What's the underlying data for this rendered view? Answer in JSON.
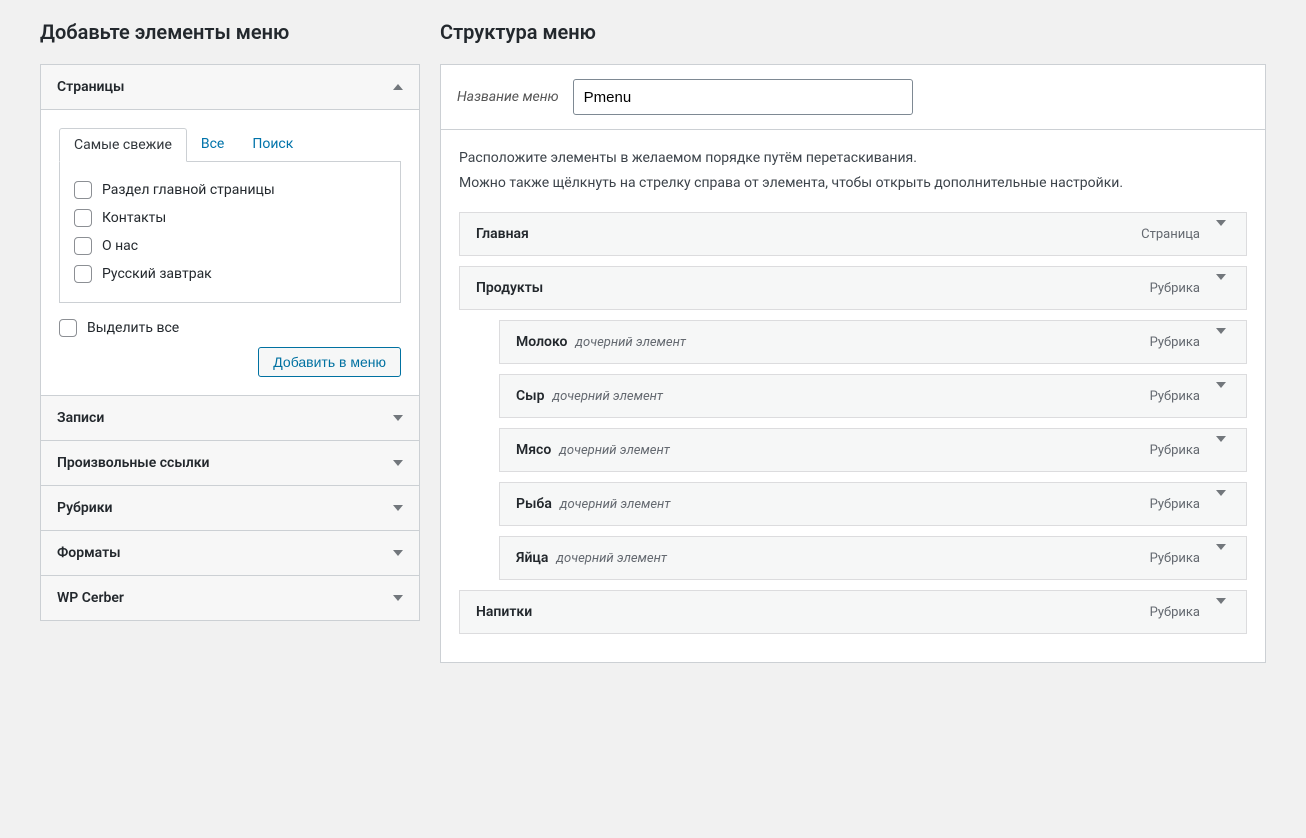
{
  "left": {
    "title": "Добавьте элементы меню",
    "panels": {
      "pages": {
        "label": "Страницы",
        "tabs": {
          "recent": "Самые свежие",
          "all": "Все",
          "search": "Поиск"
        },
        "items": [
          "Раздел главной страницы",
          "Контакты",
          "О нас",
          "Русский завтрак"
        ],
        "select_all": "Выделить все",
        "add_button": "Добавить в меню"
      },
      "posts": {
        "label": "Записи"
      },
      "custom_links": {
        "label": "Произвольные ссылки"
      },
      "categories": {
        "label": "Рубрики"
      },
      "formats": {
        "label": "Форматы"
      },
      "wpcerber": {
        "label": "WP Cerber"
      }
    }
  },
  "right": {
    "title": "Структура меню",
    "menu_name_label": "Название меню",
    "menu_name_value": "Pmenu",
    "help_line1": "Расположите элементы в желаемом порядке путём перетаскивания.",
    "help_line2": "Можно также щёлкнуть на стрелку справа от элемента, чтобы открыть дополнительные настройки.",
    "sub_label": "дочерний элемент",
    "type_page": "Страница",
    "type_category": "Рубрика",
    "items": [
      {
        "title": "Главная",
        "type": "Страница",
        "depth": 0
      },
      {
        "title": "Продукты",
        "type": "Рубрика",
        "depth": 0
      },
      {
        "title": "Молоко",
        "type": "Рубрика",
        "depth": 1
      },
      {
        "title": "Сыр",
        "type": "Рубрика",
        "depth": 1
      },
      {
        "title": "Мясо",
        "type": "Рубрика",
        "depth": 1
      },
      {
        "title": "Рыба",
        "type": "Рубрика",
        "depth": 1
      },
      {
        "title": "Яйца",
        "type": "Рубрика",
        "depth": 1
      },
      {
        "title": "Напитки",
        "type": "Рубрика",
        "depth": 0
      }
    ]
  }
}
